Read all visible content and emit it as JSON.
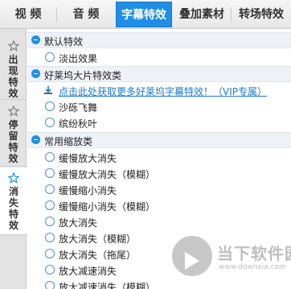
{
  "top_tabs": [
    {
      "label": "视 频",
      "active": false
    },
    {
      "label": "音 频",
      "active": false
    },
    {
      "label": "字幕特效",
      "active": true
    },
    {
      "label": "叠加素材",
      "active": false
    },
    {
      "label": "转场特效",
      "active": false
    }
  ],
  "side_tabs": [
    {
      "label": "出现特效",
      "active": false
    },
    {
      "label": "停留特效",
      "active": false
    },
    {
      "label": "消失特效",
      "active": true
    }
  ],
  "groups": [
    {
      "title": "默认特效",
      "items": [
        "淡出效果"
      ]
    },
    {
      "title": "好莱坞大片特效类",
      "link": "点击此处获取更多好莱坞字幕特效！（VIP专属）",
      "items": [
        "沙砾飞舞",
        "缤纷秋叶"
      ]
    },
    {
      "title": "常用缩放类",
      "items": [
        "缓慢放大消失",
        "缓慢放大消失（模糊）",
        "缓慢缩小消失",
        "缓慢缩小消失（模糊）",
        "放大消失",
        "放大消失（模糊）",
        "放大消失（拖尾）",
        "放大减速消失",
        "放大减速消失（模糊）"
      ]
    }
  ],
  "watermark": {
    "title": "当下软件园",
    "subtitle": "www.downxia.com"
  },
  "colors": {
    "accent": "#1d8fe6",
    "link": "#1b79d6"
  }
}
